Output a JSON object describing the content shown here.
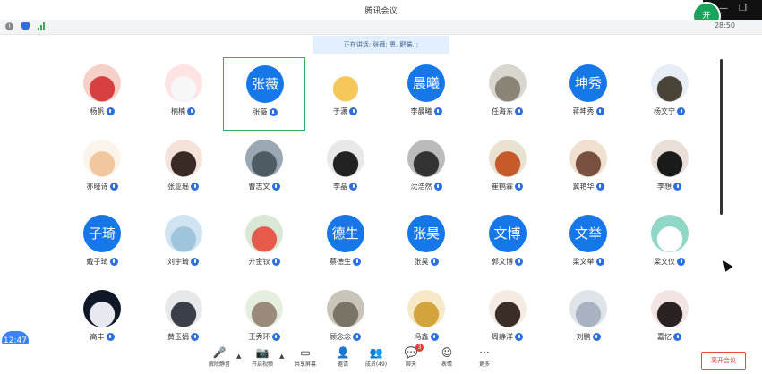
{
  "window": {
    "title": "腾讯会议",
    "timer": "28:50",
    "corner_initial": "开"
  },
  "speaking": "正在讲话: 张薇; 恩, 肥猫, ;",
  "participants": [
    {
      "name": "杨帆",
      "type": "img",
      "c1": "#f5d0c8",
      "c2": "#d64040"
    },
    {
      "name": "楠楠",
      "type": "img",
      "c1": "#fde3e3",
      "c2": "#f7f7f7"
    },
    {
      "name": "张薇",
      "type": "text",
      "avatar": "张薇",
      "active": true
    },
    {
      "name": "于潇",
      "type": "img",
      "c1": "#ffffff",
      "c2": "#f6c85a"
    },
    {
      "name": "李晨曦",
      "type": "text",
      "avatar": "晨曦"
    },
    {
      "name": "任海东",
      "type": "img",
      "c1": "#d9d6cf",
      "c2": "#8a8477"
    },
    {
      "name": "蒋坤秀",
      "type": "text",
      "avatar": "坤秀"
    },
    {
      "name": "杨文宁",
      "type": "img",
      "c1": "#e7edf5",
      "c2": "#4a4338"
    },
    {
      "name": "亦晓诗",
      "type": "img",
      "c1": "#fbf4ea",
      "c2": "#f2c7a0"
    },
    {
      "name": "张亚瑶",
      "type": "img",
      "c1": "#f5e2d8",
      "c2": "#3a2a25"
    },
    {
      "name": "曹志文",
      "type": "img",
      "c1": "#9aa8b4",
      "c2": "#4f5b63"
    },
    {
      "name": "李晶",
      "type": "img",
      "c1": "#e8e8e8",
      "c2": "#222222"
    },
    {
      "name": "沈浩然",
      "type": "img",
      "c1": "#bbbbbb",
      "c2": "#333333"
    },
    {
      "name": "崔鹤霖",
      "type": "img",
      "c1": "#e9e2d0",
      "c2": "#c65a2a"
    },
    {
      "name": "冀艳华",
      "type": "img",
      "c1": "#f0e0d0",
      "c2": "#7a5040"
    },
    {
      "name": "李想",
      "type": "img",
      "c1": "#e8e0d8",
      "c2": "#1a1a1a"
    },
    {
      "name": "戴子琦",
      "type": "text",
      "avatar": "子琦"
    },
    {
      "name": "刘宇琦",
      "type": "img",
      "c1": "#cfe3f1",
      "c2": "#9fc4dc"
    },
    {
      "name": "亓金钗",
      "type": "img",
      "c1": "#d8e8d4",
      "c2": "#e55a4a"
    },
    {
      "name": "蔡德生",
      "type": "text",
      "avatar": "德生"
    },
    {
      "name": "张昊",
      "type": "text",
      "avatar": "张昊"
    },
    {
      "name": "郭文博",
      "type": "text",
      "avatar": "文博"
    },
    {
      "name": "梁文举",
      "type": "text",
      "avatar": "文举"
    },
    {
      "name": "梁文仪",
      "type": "img",
      "c1": "#8fd8c8",
      "c2": "#ffffff"
    },
    {
      "name": "高丰",
      "type": "img",
      "c1": "#101828",
      "c2": "#e8e8f0"
    },
    {
      "name": "黄玉娟",
      "type": "img",
      "c1": "#e6e8ec",
      "c2": "#3b3f48"
    },
    {
      "name": "王秀环",
      "type": "img",
      "c1": "#e5efe0",
      "c2": "#9a8a7a"
    },
    {
      "name": "顾念念",
      "type": "img",
      "c1": "#c8c4b8",
      "c2": "#7a7466"
    },
    {
      "name": "冯鑫",
      "type": "img",
      "c1": "#f6e9c8",
      "c2": "#d4a43c"
    },
    {
      "name": "周静洋",
      "type": "img",
      "c1": "#f4ece2",
      "c2": "#3a2c26"
    },
    {
      "name": "刘鹏",
      "type": "img",
      "c1": "#dfe3ea",
      "c2": "#a8b2c2"
    },
    {
      "name": "嘉忆",
      "type": "img",
      "c1": "#f3e4e4",
      "c2": "#2a2222"
    }
  ],
  "toolbar": {
    "items": [
      {
        "id": "mute",
        "label": "解除静音",
        "glyph": "🎤"
      },
      {
        "id": "video",
        "label": "开启视频",
        "glyph": "📷"
      },
      {
        "id": "share",
        "label": "共享屏幕",
        "glyph": "▭"
      },
      {
        "id": "invite",
        "label": "邀请",
        "glyph": "👤"
      },
      {
        "id": "members",
        "label": "成员(49)",
        "glyph": "👥"
      },
      {
        "id": "chat",
        "label": "聊天",
        "glyph": "💬",
        "badge": "3"
      },
      {
        "id": "emoji",
        "label": "表情",
        "glyph": "☺"
      },
      {
        "id": "more",
        "label": "更多",
        "glyph": "···"
      }
    ],
    "leave": "离开会议"
  },
  "clock": "12:47",
  "colors": {
    "accent": "#1677e9",
    "speaking_bg": "#e3effc",
    "active_border": "#2fae66",
    "leave": "#e03c3c"
  }
}
